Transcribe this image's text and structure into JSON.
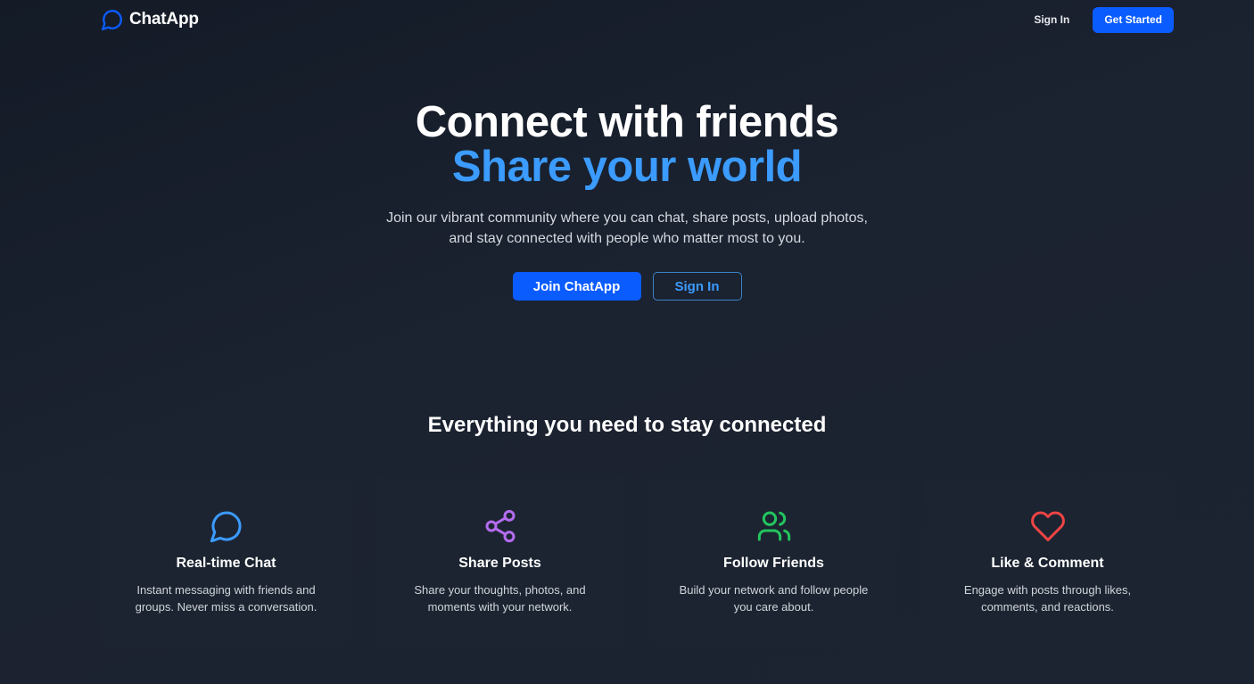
{
  "nav": {
    "brand": "ChatApp",
    "brand_icon": "chat-bubble-icon",
    "sign_in": "Sign In",
    "get_started": "Get Started"
  },
  "hero": {
    "title_line1": "Connect with friends",
    "title_line2": "Share your world",
    "description": "Join our vibrant community where you can chat, share posts, upload photos, and stay connected with people who matter most to you.",
    "primary_button": "Join ChatApp",
    "secondary_button": "Sign In"
  },
  "features": {
    "title": "Everything you need to stay connected",
    "items": [
      {
        "icon": "chat-bubble-icon",
        "color": "#3b9bff",
        "title": "Real-time Chat",
        "description": "Instant messaging with friends and groups. Never miss a conversation."
      },
      {
        "icon": "share-icon",
        "color": "#b46cf0",
        "title": "Share Posts",
        "description": "Share your thoughts, photos, and moments with your network."
      },
      {
        "icon": "users-icon",
        "color": "#22c55e",
        "title": "Follow Friends",
        "description": "Build your network and follow people you care about."
      },
      {
        "icon": "heart-icon",
        "color": "#ef4444",
        "title": "Like & Comment",
        "description": "Engage with posts through likes, comments, and reactions."
      }
    ]
  },
  "colors": {
    "accent": "#0b5cff",
    "highlight": "#3b9bff",
    "background": "#1b2230",
    "card": "#1c2431"
  }
}
